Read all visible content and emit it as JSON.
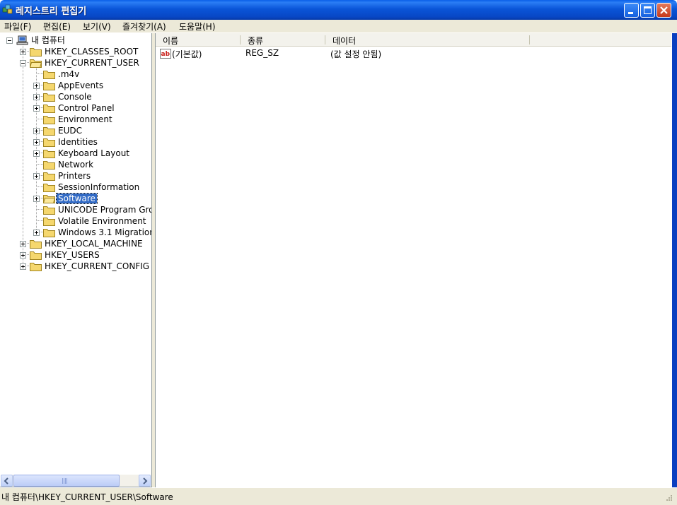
{
  "window": {
    "title": "레지스트리 편집기"
  },
  "menu": [
    "파일(F)",
    "편집(E)",
    "보기(V)",
    "즐겨찾기(A)",
    "도움말(H)"
  ],
  "tree": {
    "root": "내 컴퓨터",
    "hkeys": {
      "classes_root": "HKEY_CLASSES_ROOT",
      "current_user": "HKEY_CURRENT_USER",
      "local_machine": "HKEY_LOCAL_MACHINE",
      "users": "HKEY_USERS",
      "current_config": "HKEY_CURRENT_CONFIG"
    },
    "current_user_children": [
      ".m4v",
      "AppEvents",
      "Console",
      "Control Panel",
      "Environment",
      "EUDC",
      "Identities",
      "Keyboard Layout",
      "Network",
      "Printers",
      "SessionInformation",
      "Software",
      "UNICODE Program Gro",
      "Volatile Environment",
      "Windows 3.1 Migration"
    ],
    "selected": "Software"
  },
  "list": {
    "columns": {
      "name": "이름",
      "type": "종류",
      "data": "데이터"
    },
    "rows": [
      {
        "name": "(기본값)",
        "type": "REG_SZ",
        "data": "(값 설정 안됨)"
      }
    ]
  },
  "status": {
    "path": "내 컴퓨터\\HKEY_CURRENT_USER\\Software"
  },
  "colors": {
    "title_bar": "#0a55d8",
    "selection": "#316ac5",
    "chrome": "#ece9d8"
  },
  "icons": [
    "registry-editor-icon",
    "computer-icon",
    "folder-icon",
    "string-value-icon"
  ]
}
